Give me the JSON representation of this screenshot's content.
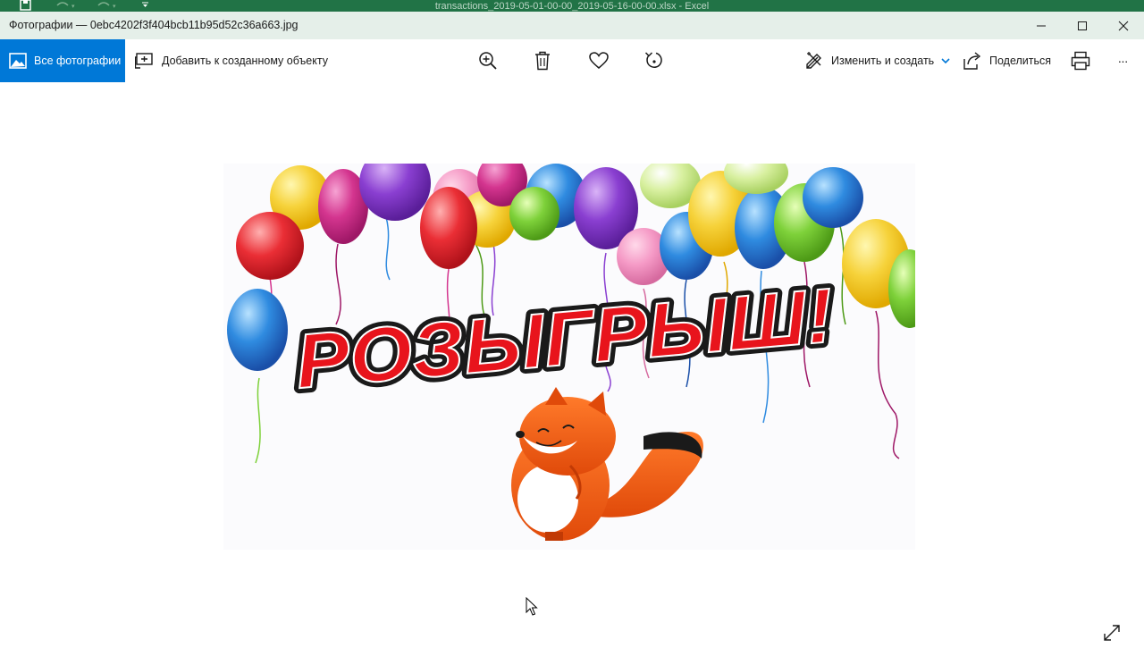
{
  "background_app": {
    "title": "transactions_2019-05-01-00-00_2019-05-16-00-00.xlsx - Excel"
  },
  "window": {
    "title": "Фотографии — 0ebc4202f3f404bcb11b95d52c36a663.jpg"
  },
  "toolbar": {
    "all_photos": "Все фотографии",
    "add_to_creation": "Добавить к созданному объекту",
    "edit_create": "Изменить и создать",
    "share": "Поделиться",
    "more": "···"
  },
  "photo": {
    "banner_text": "РОЗЫГРЫШ!"
  },
  "colors": {
    "accent": "#0078d7",
    "titlebar": "#e5efe9",
    "excel_green": "#217346"
  }
}
